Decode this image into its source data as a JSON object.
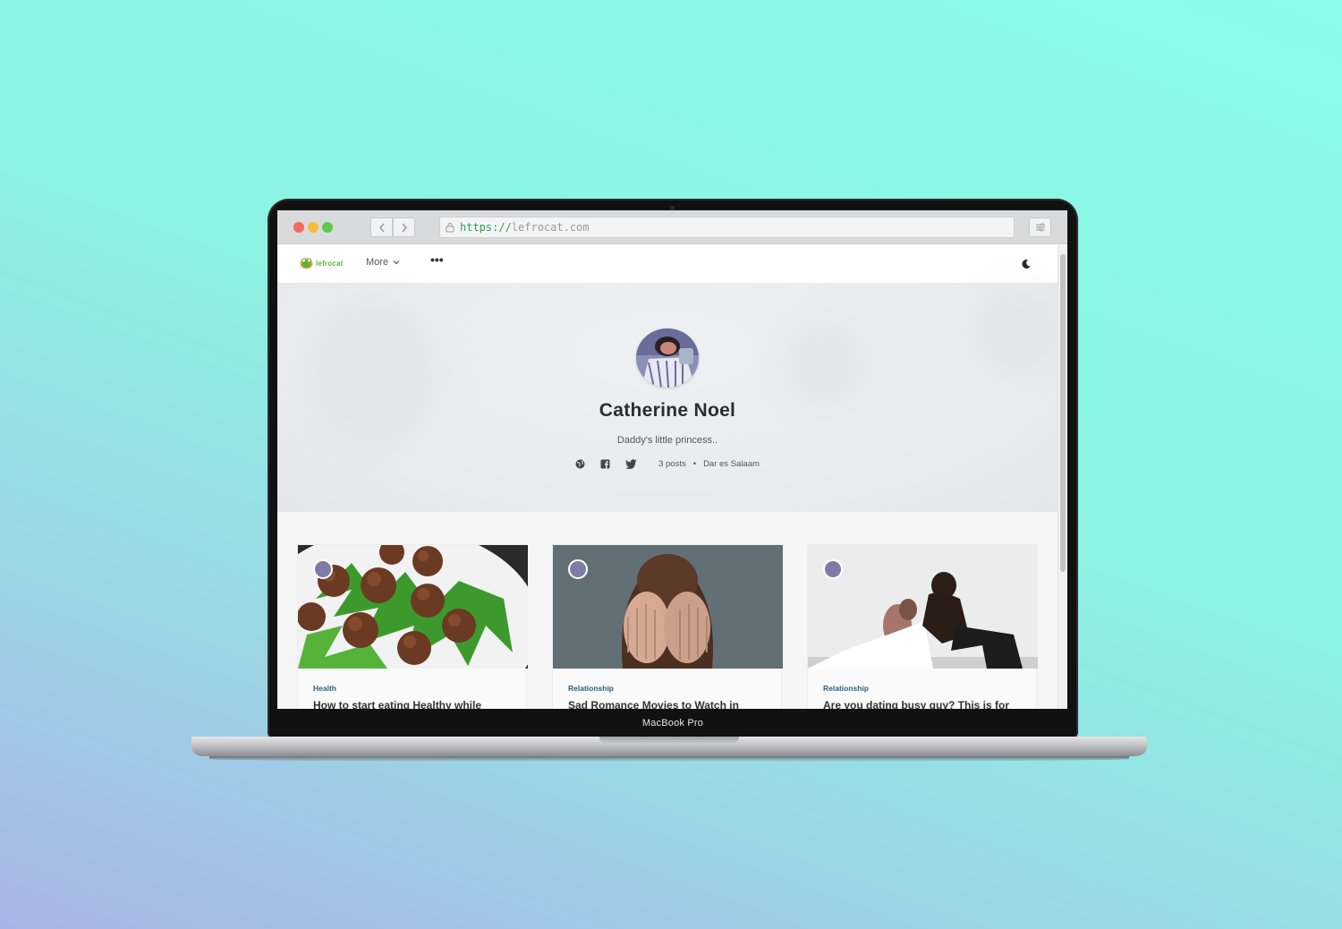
{
  "device": {
    "label": "MacBook Pro"
  },
  "browser": {
    "url_scheme": "https://",
    "url_host": "lefrocat.com"
  },
  "site": {
    "logo_text": "lefrocat",
    "nav_more_label": "More",
    "brand_color": "#58b23e"
  },
  "profile": {
    "name": "Catherine Noel",
    "bio": "Daddy's little princess..",
    "posts_count": "3 posts",
    "separator": "•",
    "location": "Dar es Salaam",
    "social_icons": [
      "globe-icon",
      "facebook-icon",
      "twitter-icon"
    ]
  },
  "posts": [
    {
      "category": "Health",
      "title": "How to start eating Healthy while"
    },
    {
      "category": "Relationship",
      "title": "Sad Romance Movies to Watch in"
    },
    {
      "category": "Relationship",
      "title": "Are you dating busy guy? This is for"
    }
  ]
}
